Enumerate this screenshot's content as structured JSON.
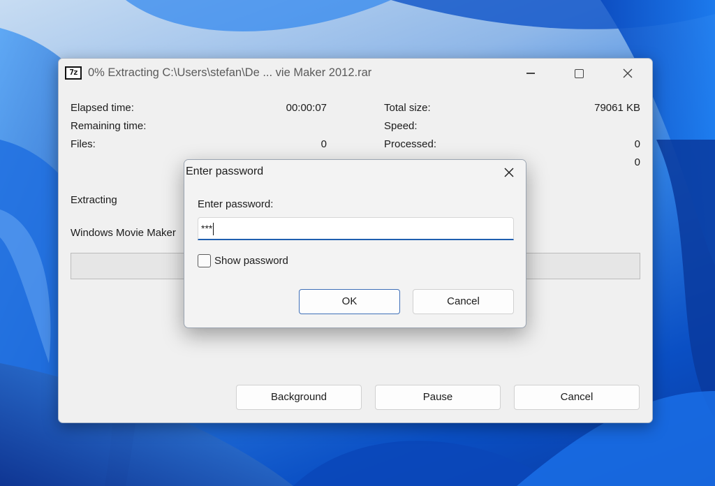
{
  "main_window": {
    "title": "0% Extracting C:\\Users\\stefan\\De ... vie Maker 2012.rar",
    "app_icon_text": "7z",
    "stats_left": [
      {
        "label": "Elapsed time:",
        "value": "00:00:07"
      },
      {
        "label": "Remaining time:",
        "value": ""
      },
      {
        "label": "Files:",
        "value": "0"
      }
    ],
    "stats_right": [
      {
        "label": "Total size:",
        "value": "79061 KB"
      },
      {
        "label": "Speed:",
        "value": ""
      },
      {
        "label": "Processed:",
        "value": "0"
      },
      {
        "label": "",
        "value": "0"
      }
    ],
    "status_text": "Extracting",
    "current_file": "Windows Movie Maker",
    "progress_fraction": 0.0,
    "buttons": {
      "background": "Background",
      "pause": "Pause",
      "cancel": "Cancel"
    }
  },
  "password_dialog": {
    "title": "Enter password",
    "label": "Enter password:",
    "password_value": "***",
    "show_password_label": "Show password",
    "show_password_checked": false,
    "ok_label": "OK",
    "cancel_label": "Cancel"
  },
  "colors": {
    "accent": "#1f5fb0",
    "progress": "#06b025",
    "wallpaper": "#0a5fd0"
  },
  "icons": {
    "app": "7zip-icon",
    "minimize": "minimize-icon",
    "maximize": "maximize-icon",
    "close": "close-icon"
  }
}
